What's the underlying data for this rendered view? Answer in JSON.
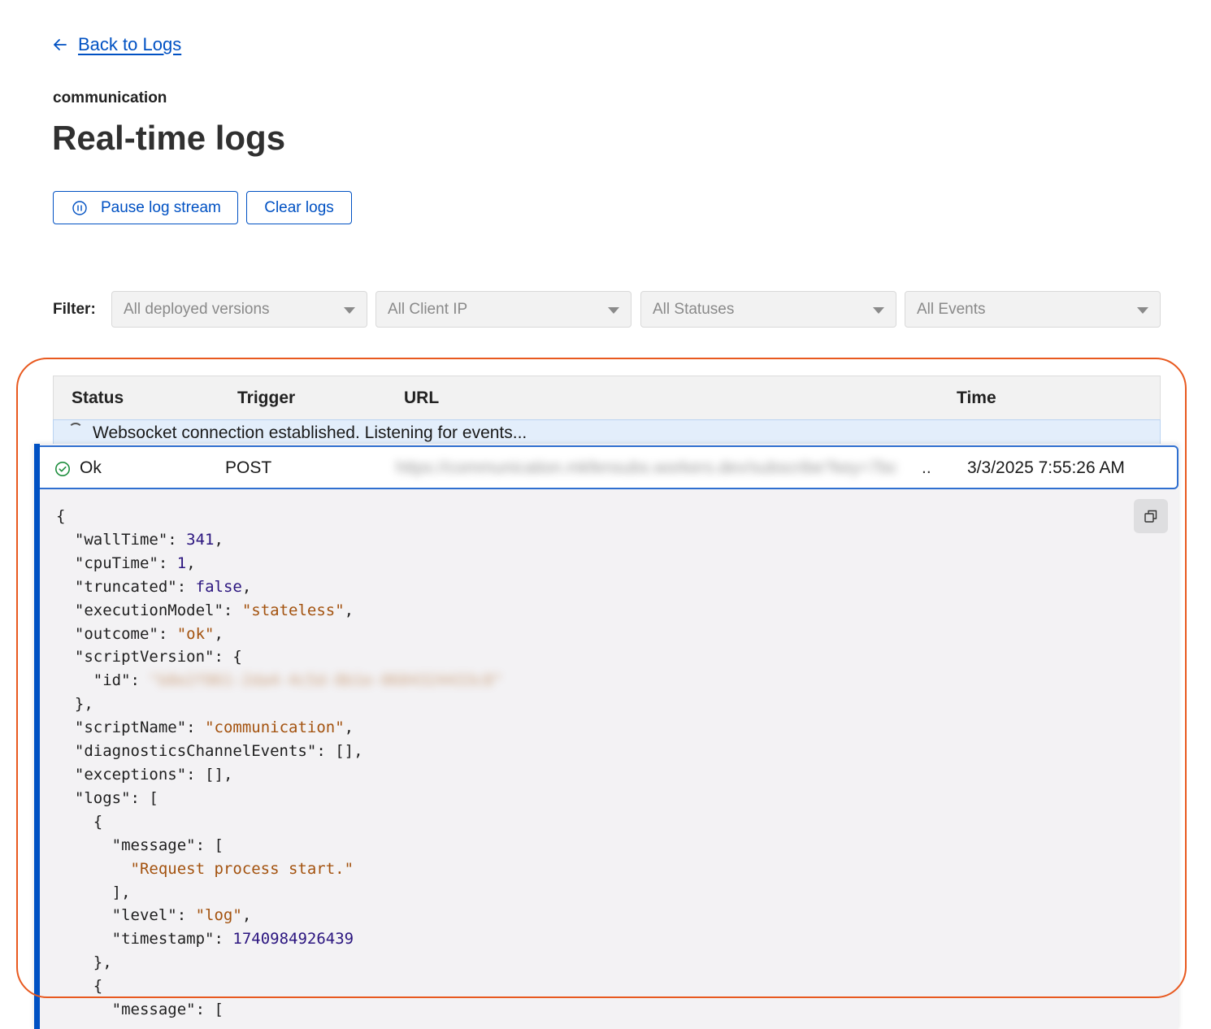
{
  "nav": {
    "back_label": "Back to Logs"
  },
  "header": {
    "worker_name": "communication",
    "title": "Real-time logs"
  },
  "actions": {
    "pause_label": "Pause log stream",
    "clear_label": "Clear logs"
  },
  "filters": {
    "label": "Filter:",
    "selects": [
      "All deployed versions",
      "All Client IP",
      "All Statuses",
      "All Events"
    ]
  },
  "table": {
    "columns": [
      "Status",
      "Trigger",
      "URL",
      "Time"
    ],
    "banner": "Websocket connection established. Listening for events...",
    "rows": [
      {
        "status": "Ok",
        "trigger": "POST",
        "url": "https://communication.mkfensubs.workers.dev/subscribe?key=7bc",
        "url_ellipsis": "..",
        "time": "3/3/2025 7:55:26 AM"
      }
    ]
  },
  "log_json": {
    "open_brace": "{",
    "wallTime_key": "\"wallTime\"",
    "wallTime_val": "341",
    "cpuTime_key": "\"cpuTime\"",
    "cpuTime_val": "1",
    "truncated_key": "\"truncated\"",
    "truncated_val": "false",
    "executionModel_key": "\"executionModel\"",
    "executionModel_val": "\"stateless\"",
    "outcome_key": "\"outcome\"",
    "outcome_val": "\"ok\"",
    "scriptVersion_key": "\"scriptVersion\"",
    "id_key": "\"id\"",
    "id_val": "\"b8e2f861-2da4-4c5d-8b1e-0684324433c8\"",
    "scriptName_key": "\"scriptName\"",
    "scriptName_val": "\"communication\"",
    "diagnostics_key": "\"diagnosticsChannelEvents\"",
    "diagnostics_val": "[]",
    "exceptions_key": "\"exceptions\"",
    "exceptions_val": "[]",
    "logs_key": "\"logs\"",
    "message_key": "\"message\"",
    "message_val": "\"Request process start.\"",
    "level_key": "\"level\"",
    "level_val": "\"log\"",
    "timestamp_key": "\"timestamp\"",
    "timestamp_val": "1740984926439"
  },
  "colors": {
    "accent": "#0051c3",
    "highlight": "#e8591f",
    "ok": "#1e8e3e",
    "string": "#a3520e",
    "number": "#2b157f"
  },
  "icons": [
    "arrow-left-icon",
    "pause-circle-icon",
    "chevron-down-icon",
    "spinner-icon",
    "check-circle-icon",
    "copy-icon"
  ]
}
